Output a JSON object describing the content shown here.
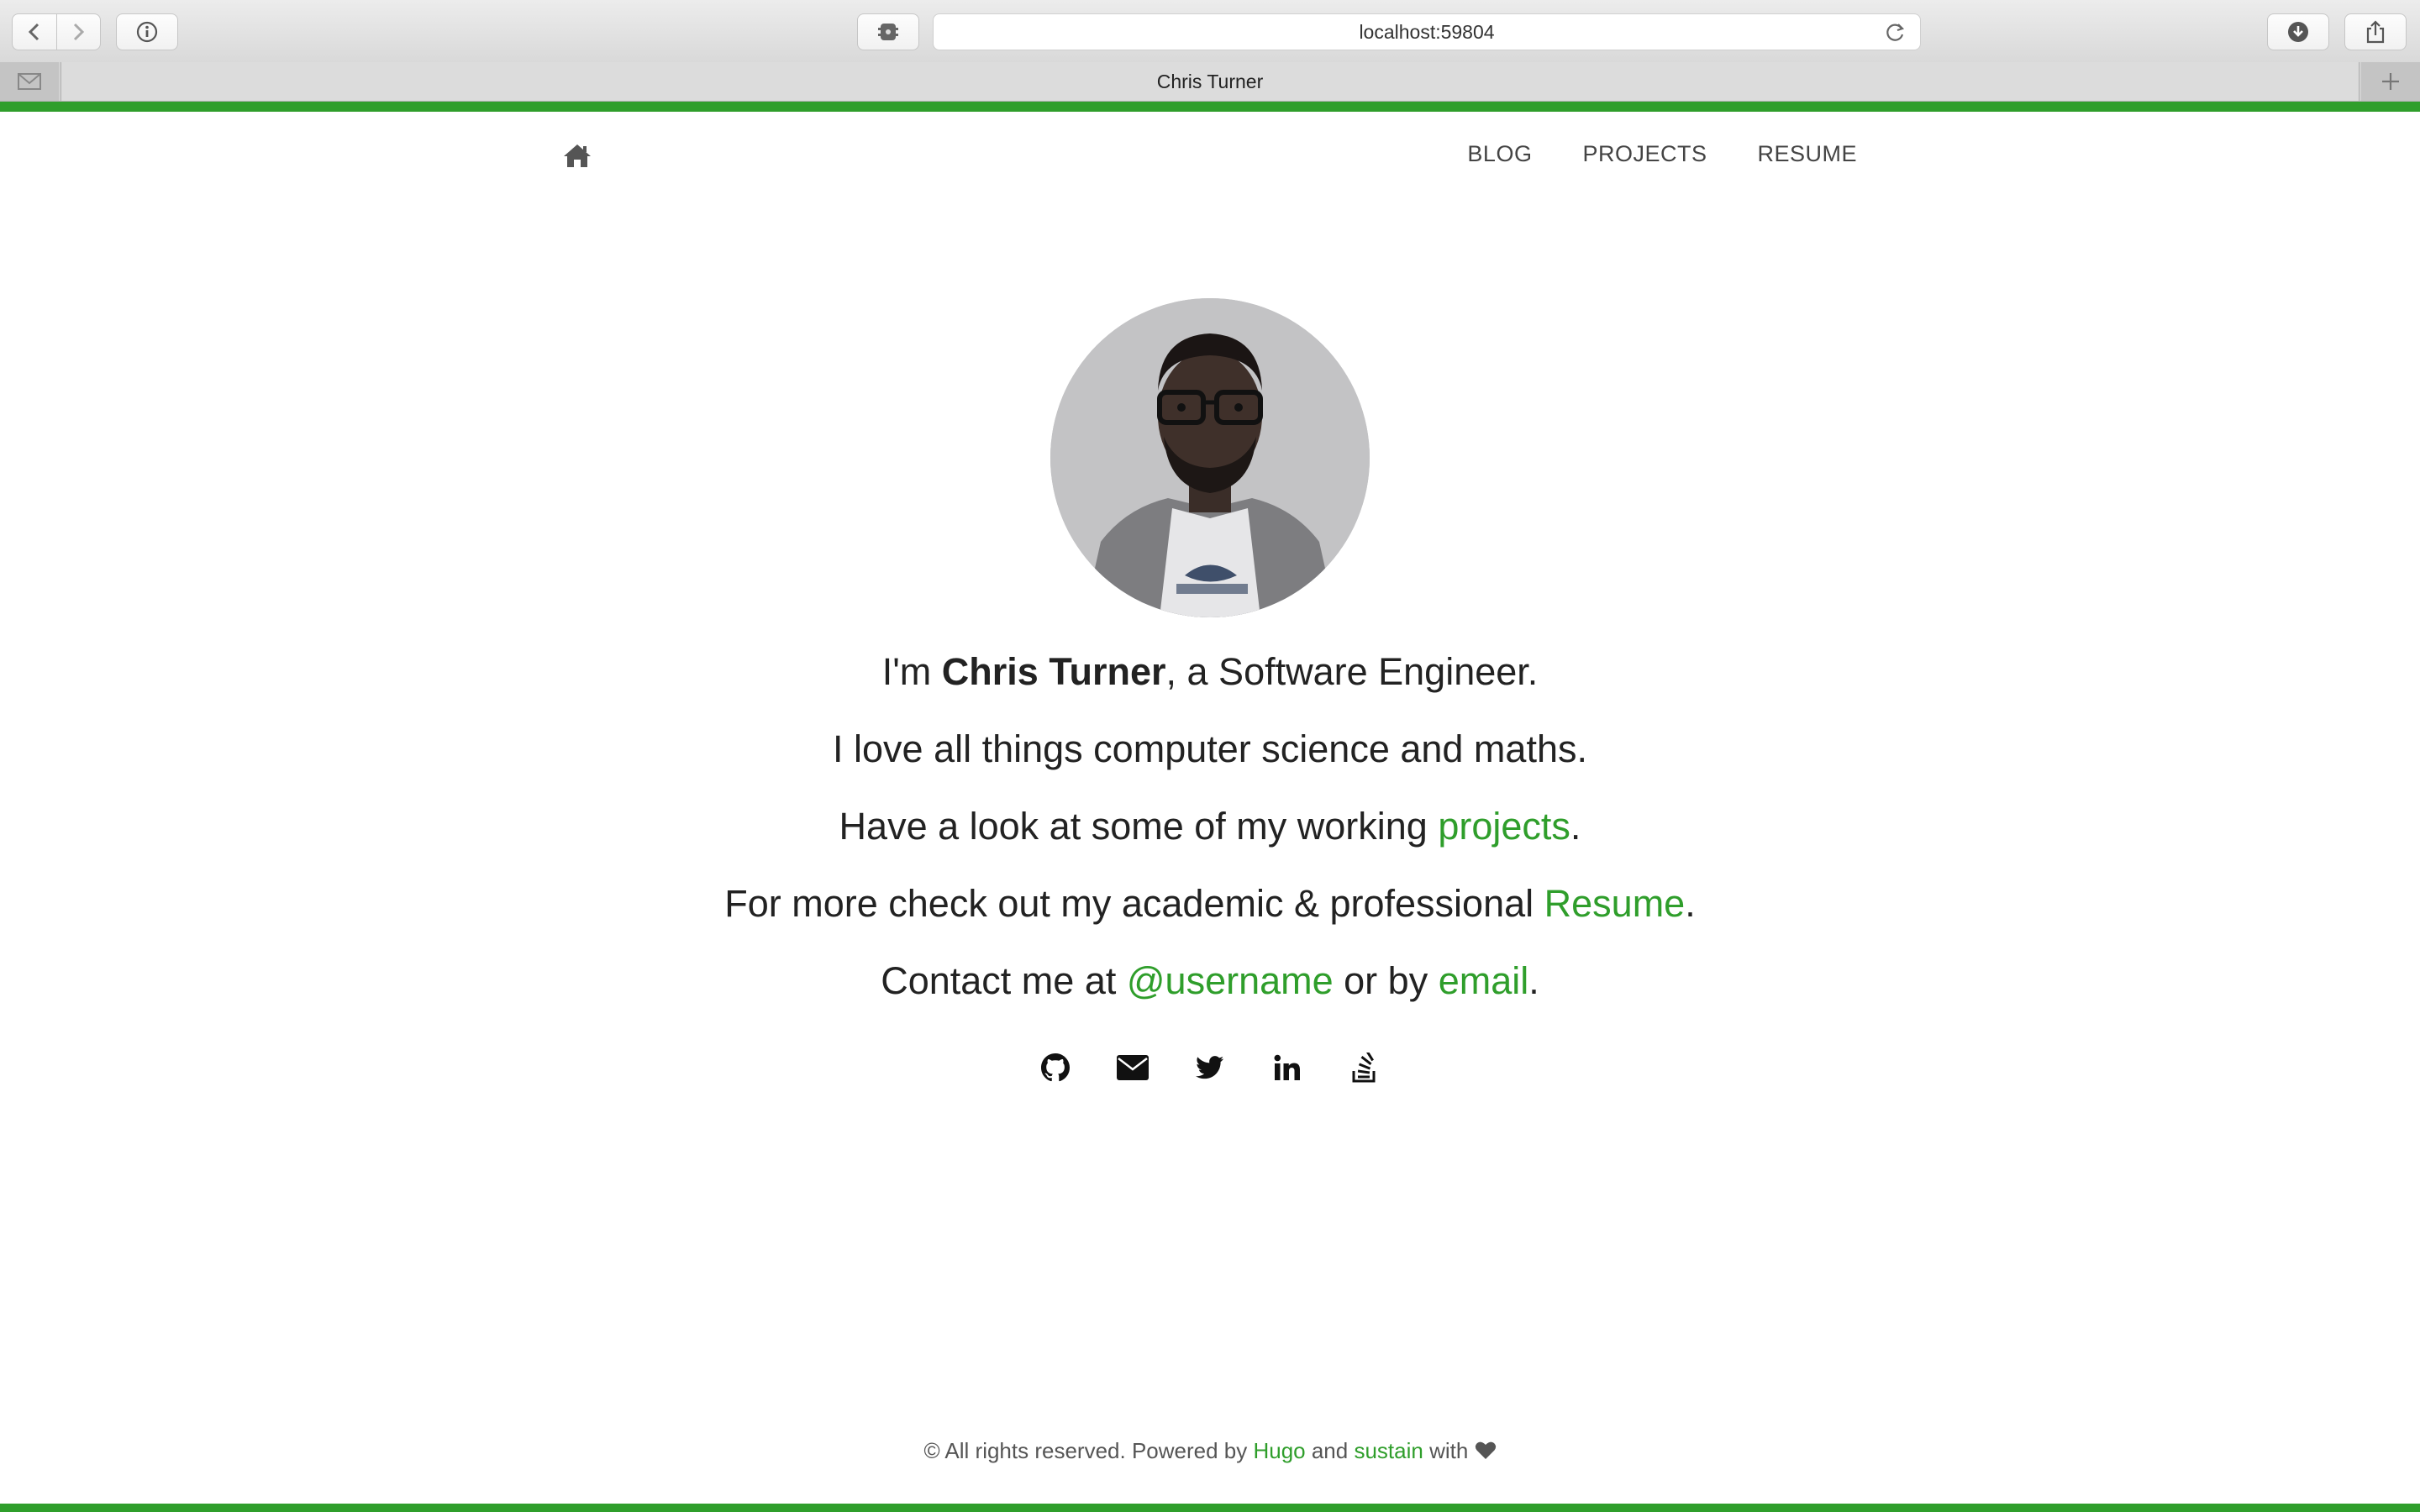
{
  "browser": {
    "url": "localhost:59804",
    "tab_title": "Chris Turner"
  },
  "nav": {
    "items": [
      {
        "label": "BLOG"
      },
      {
        "label": "PROJECTS"
      },
      {
        "label": "RESUME"
      }
    ]
  },
  "profile": {
    "line1_prefix": "I'm ",
    "name": "Chris Turner",
    "line1_suffix": ", a Software Engineer.",
    "line2": "I love all things computer science and maths.",
    "line3_prefix": "Have a look at some of my working ",
    "line3_link": "projects",
    "line3_suffix": ".",
    "line4_prefix": "For more check out my academic & professional ",
    "line4_link": "Resume",
    "line4_suffix": ".",
    "line5_prefix": "Contact me at ",
    "line5_link1": "@username",
    "line5_mid": " or by ",
    "line5_link2": "email",
    "line5_suffix": "."
  },
  "social_icons": [
    "github-icon",
    "envelope-icon",
    "twitter-icon",
    "linkedin-icon",
    "stackoverflow-icon"
  ],
  "footer": {
    "prefix": "© All rights reserved. Powered by ",
    "link1": "Hugo",
    "mid": " and ",
    "link2": "sustain",
    "suffix": " with "
  },
  "colors": {
    "accent": "#2f9e2b",
    "text": "#222222"
  }
}
